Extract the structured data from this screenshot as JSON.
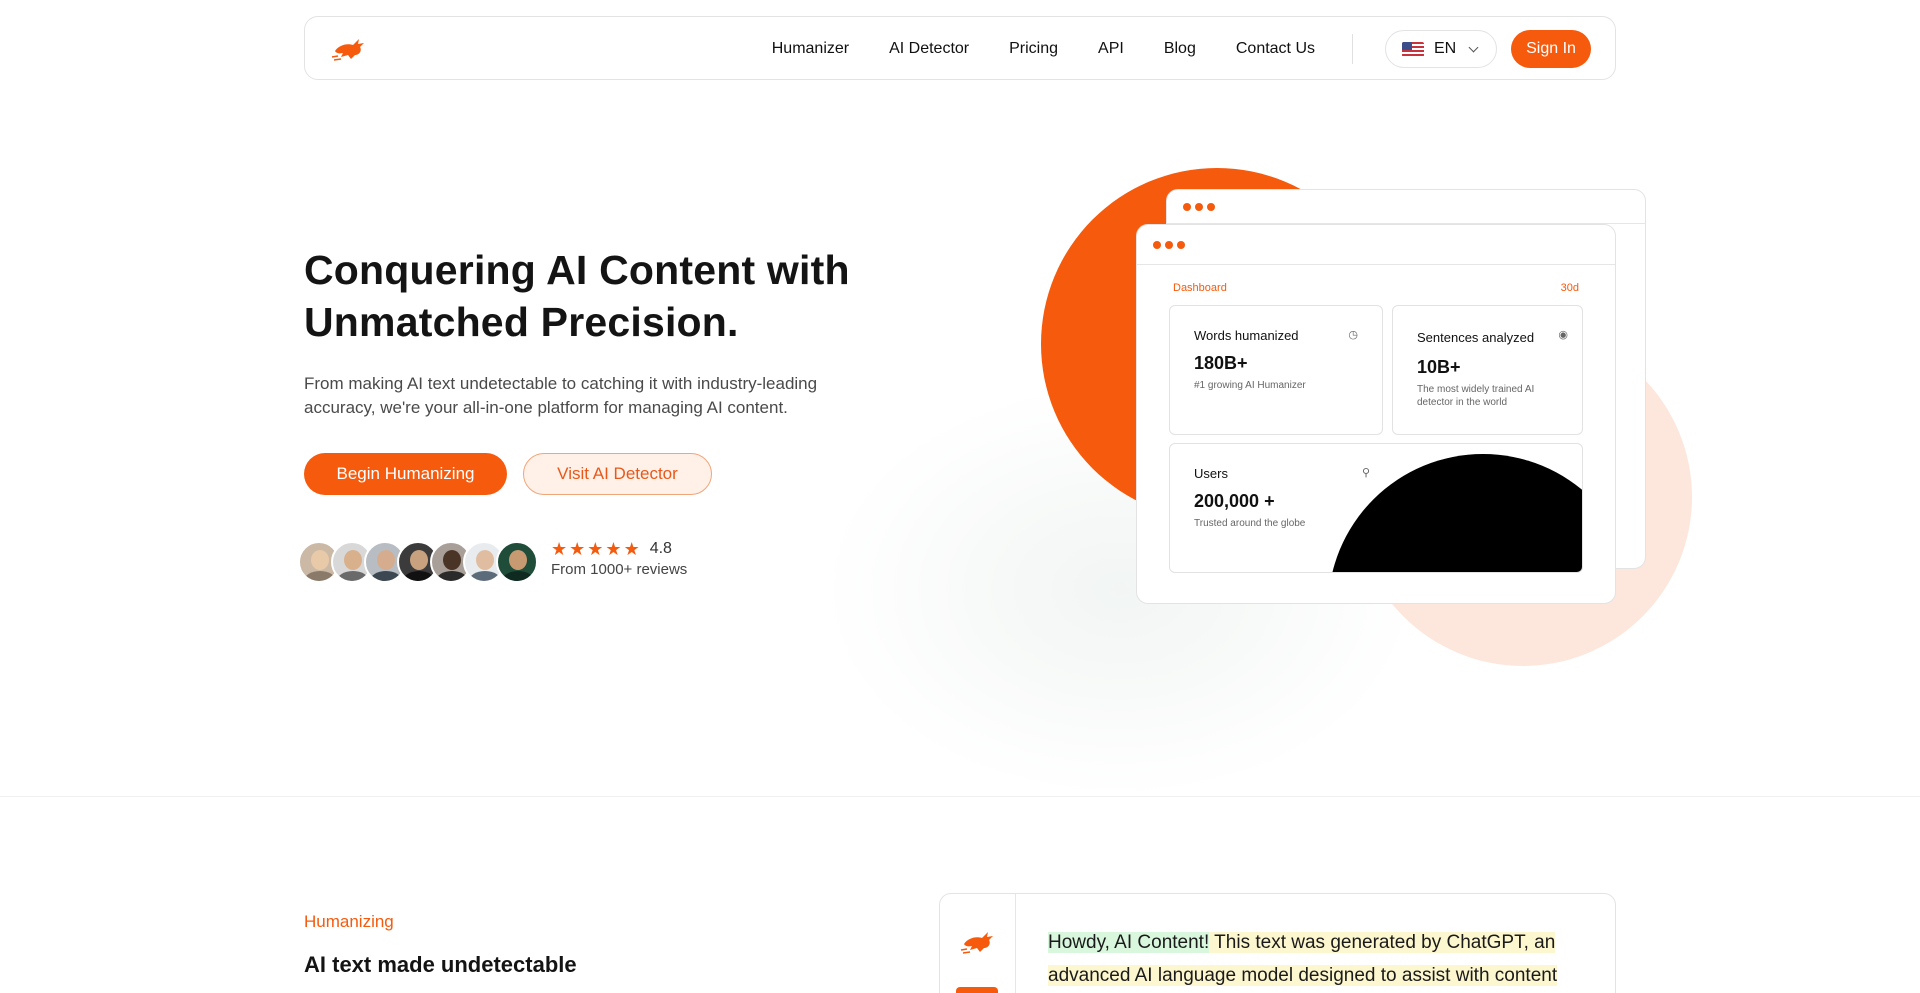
{
  "nav": {
    "logo_icon": "rabbit-logo-icon",
    "links": [
      "Humanizer",
      "AI Detector",
      "Pricing",
      "API",
      "Blog",
      "Contact Us"
    ],
    "language": "EN",
    "language_flag_icon": "us-flag-icon",
    "sign_in": "Sign In"
  },
  "hero": {
    "title": "Conquering AI Content with Unmatched Precision.",
    "subtitle": "From making AI text undetectable to catching it with industry-leading accuracy, we're your all-in-one platform for managing AI content.",
    "primary_cta": "Begin Humanizing",
    "secondary_cta": "Visit AI Detector",
    "rating": "4.8",
    "stars": 5,
    "reviews": "From 1000+ reviews"
  },
  "dashboard": {
    "label": "Dashboard",
    "period": "30d",
    "cards": [
      {
        "title": "Words humanized",
        "icon": "clock-icon",
        "value": "180B+",
        "desc": "#1 growing AI Humanizer"
      },
      {
        "title": "Sentences analyzed",
        "icon": "eye-icon",
        "value": "10B+",
        "desc": "The most widely trained AI detector in the world"
      },
      {
        "title": "Users",
        "icon": "user-icon",
        "value": "200,000 +",
        "desc": "Trusted around the globe"
      }
    ]
  },
  "humanizing": {
    "eyebrow": "Humanizing",
    "title": "AI text made undetectable",
    "demo_highlight": "Howdy, AI Content!",
    "demo_text": " This text was generated by ChatGPT, an advanced AI language model designed to assist with content"
  },
  "colors": {
    "accent": "#f55a0d",
    "peach": "#fde6dc",
    "highlight_green": "#d9f7dc",
    "highlight_yellow": "#fdf7cf"
  }
}
